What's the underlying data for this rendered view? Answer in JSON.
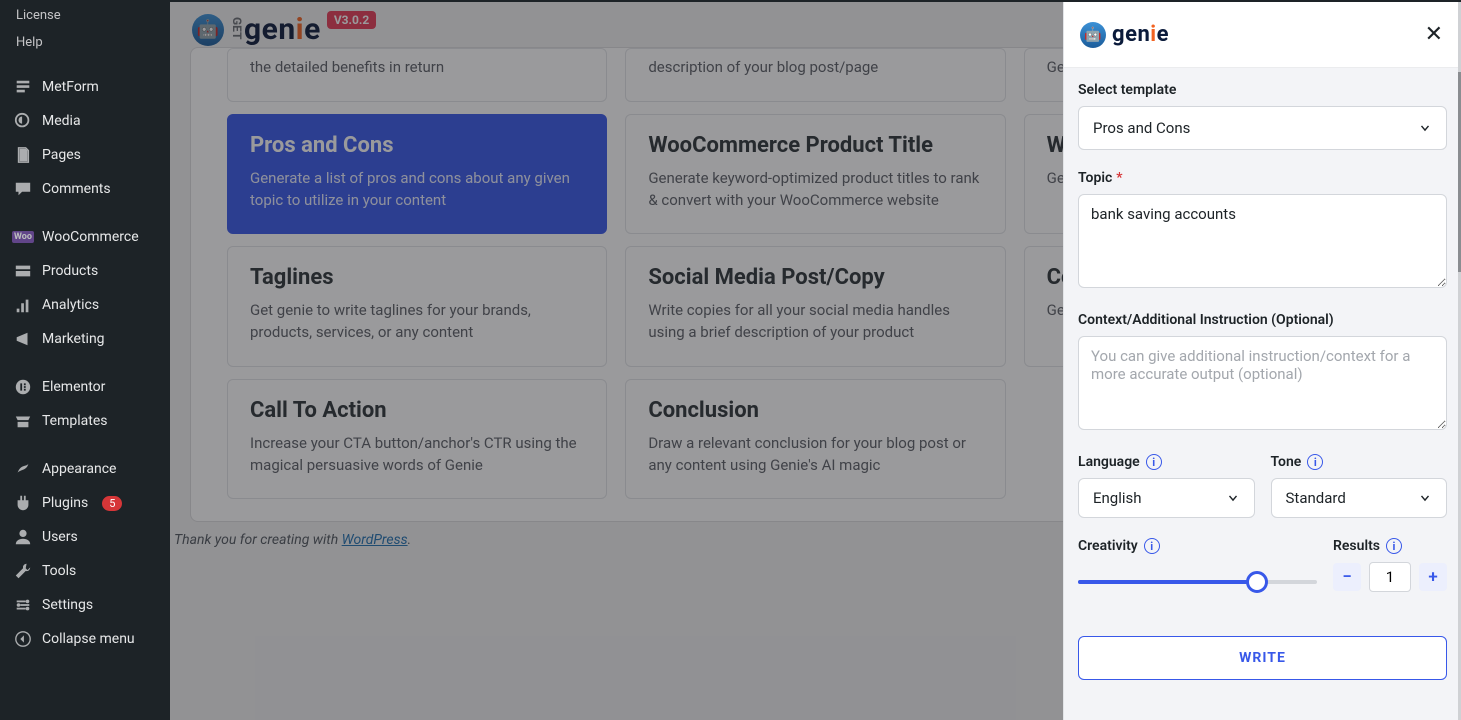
{
  "sidebar": {
    "top_items": [
      "License",
      "Help"
    ],
    "items": [
      {
        "icon": "metform",
        "label": "MetForm"
      },
      {
        "icon": "media",
        "label": "Media"
      },
      {
        "icon": "pages",
        "label": "Pages"
      },
      {
        "icon": "comments",
        "label": "Comments"
      }
    ],
    "items2": [
      {
        "icon": "woo",
        "label": "WooCommerce"
      },
      {
        "icon": "products",
        "label": "Products"
      },
      {
        "icon": "analytics",
        "label": "Analytics"
      },
      {
        "icon": "marketing",
        "label": "Marketing"
      }
    ],
    "items3": [
      {
        "icon": "elementor",
        "label": "Elementor"
      },
      {
        "icon": "templates",
        "label": "Templates"
      }
    ],
    "items4": [
      {
        "icon": "appearance",
        "label": "Appearance"
      },
      {
        "icon": "plugins",
        "label": "Plugins",
        "badge": "5"
      },
      {
        "icon": "users",
        "label": "Users"
      },
      {
        "icon": "tools",
        "label": "Tools"
      },
      {
        "icon": "settings",
        "label": "Settings"
      }
    ],
    "collapse": "Collapse menu"
  },
  "brand": {
    "name": "genie",
    "version": "V3.0.2"
  },
  "cards_row_top": [
    {
      "desc": "the detailed benefits in return"
    },
    {
      "desc": "description of your blog post/page"
    },
    {
      "desc": "Gen\nfrien\nprod"
    }
  ],
  "cards_row1": [
    {
      "title": "Pros and Cons",
      "desc": "Generate a list of pros and cons about any given topic to utilize in your content",
      "active": true
    },
    {
      "title": "WooCommerce Product Title",
      "desc": "Generate keyword-optimized product titles to rank & convert with your WooCommerce website"
    },
    {
      "title": "Wo\nDe",
      "desc": "Get\nWoc\ndesi"
    }
  ],
  "cards_row2": [
    {
      "title": "Taglines",
      "desc": "Get genie to write taglines for your brands, products, services, or any content"
    },
    {
      "title": "Social Media Post/Copy",
      "desc": "Write copies for all your social media handles using a brief description of your product"
    },
    {
      "title": "Co",
      "desc": "Get\nsent"
    }
  ],
  "cards_row3": [
    {
      "title": "Call To Action",
      "desc": "Increase your CTA button/anchor's CTR using the magical persuasive words of Genie"
    },
    {
      "title": "Conclusion",
      "desc": "Draw a relevant conclusion for your blog post or any content using Genie's AI magic"
    }
  ],
  "footer": {
    "text": "Thank you for creating with ",
    "link": "WordPress",
    "suffix": "."
  },
  "panel": {
    "select_label": "Select template",
    "select_value": "Pros and Cons",
    "topic_label": "Topic",
    "topic_value": "bank saving accounts",
    "context_label": "Context/Additional Instruction (Optional)",
    "context_placeholder": "You can give additional instruction/context for a more accurate output (optional)",
    "language_label": "Language",
    "language_value": "English",
    "tone_label": "Tone",
    "tone_value": "Standard",
    "creativity_label": "Creativity",
    "results_label": "Results",
    "results_value": "1",
    "write": "WRITE"
  }
}
